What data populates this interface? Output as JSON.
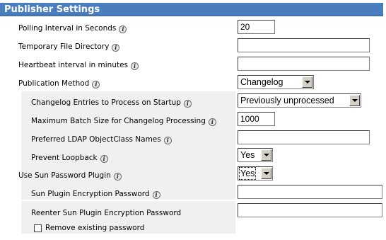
{
  "title": "Publisher Settings",
  "fields": {
    "polling_interval": {
      "label": "Polling Interval in Seconds",
      "value": "20"
    },
    "temp_dir": {
      "label": "Temporary File Directory",
      "value": ""
    },
    "heartbeat": {
      "label": "Heartbeat interval in minutes",
      "value": ""
    },
    "publication_method": {
      "label": "Publication Method",
      "value": "Changelog"
    },
    "changelog_entries": {
      "label": "Changelog Entries to Process on Startup",
      "value": "Previously unprocessed"
    },
    "max_batch": {
      "label": "Maximum Batch Size for Changelog Processing",
      "value": "1000"
    },
    "ldap_classnames": {
      "label": "Preferred LDAP ObjectClass Names",
      "value": ""
    },
    "prevent_loopback": {
      "label": "Prevent Loopback",
      "value": "Yes"
    },
    "sun_password_plugin": {
      "label": "Use Sun Password Plugin",
      "value": "Yes"
    },
    "sun_encryption_password": {
      "label": "Sun Plugin Encryption Password",
      "value": ""
    },
    "reenter_password": {
      "label": "Reenter Sun Plugin Encryption Password",
      "value": ""
    },
    "remove_existing": {
      "label": "Remove existing password",
      "checked": false
    }
  },
  "icons": {
    "info": "info-icon",
    "info_glyph": "i",
    "dropdown": "chevron-down-icon"
  },
  "colors": {
    "header_bg": "#4a7dbd",
    "panel_bg": "#f0f0f0"
  }
}
